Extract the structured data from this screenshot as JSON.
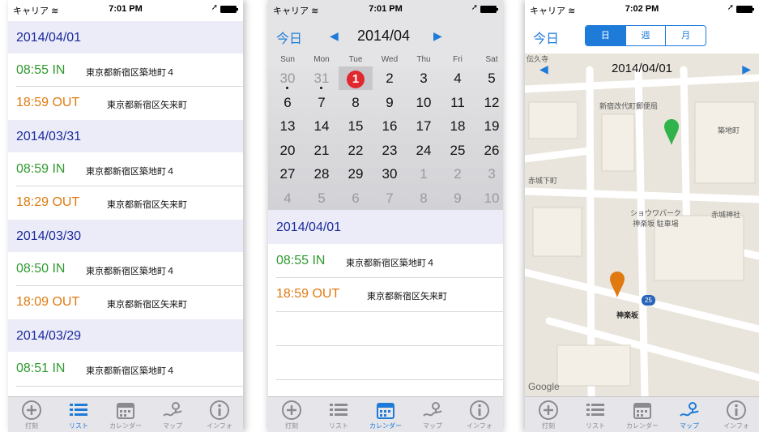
{
  "status": {
    "carrier": "キャリア",
    "time_1": "7:01 PM",
    "time_2": "7:01 PM",
    "time_3": "7:02 PM"
  },
  "list_screen": {
    "groups": [
      {
        "date": "2014/04/01",
        "events": [
          {
            "time": "08:55 IN",
            "addr": "東京都新宿区築地町４"
          },
          {
            "time": "18:59 OUT",
            "addr": "東京都新宿区矢来町"
          }
        ]
      },
      {
        "date": "2014/03/31",
        "events": [
          {
            "time": "08:59 IN",
            "addr": "東京都新宿区築地町４"
          },
          {
            "time": "18:29 OUT",
            "addr": "東京都新宿区矢来町"
          }
        ]
      },
      {
        "date": "2014/03/30",
        "events": [
          {
            "time": "08:50 IN",
            "addr": "東京都新宿区築地町４"
          },
          {
            "time": "18:09 OUT",
            "addr": "東京都新宿区矢来町"
          }
        ]
      },
      {
        "date": "2014/03/29",
        "events": [
          {
            "time": "08:51 IN",
            "addr": "東京都新宿区築地町４"
          }
        ]
      }
    ]
  },
  "calendar_screen": {
    "today_label": "今日",
    "month": "2014/04",
    "weekdays": [
      "Sun",
      "Mon",
      "Tue",
      "Wed",
      "Thu",
      "Fri",
      "Sat"
    ],
    "weeks": [
      [
        "30",
        "31",
        "1",
        "2",
        "3",
        "4",
        "5"
      ],
      [
        "6",
        "7",
        "8",
        "9",
        "10",
        "11",
        "12"
      ],
      [
        "13",
        "14",
        "15",
        "16",
        "17",
        "18",
        "19"
      ],
      [
        "20",
        "21",
        "22",
        "23",
        "24",
        "25",
        "26"
      ],
      [
        "27",
        "28",
        "29",
        "30",
        "1",
        "2",
        "3"
      ],
      [
        "4",
        "5",
        "6",
        "7",
        "8",
        "9",
        "10"
      ]
    ],
    "selected_date": "2014/04/01",
    "events": [
      {
        "time": "08:55 IN",
        "addr": "東京都新宿区築地町４"
      },
      {
        "time": "18:59 OUT",
        "addr": "東京都新宿区矢来町"
      }
    ]
  },
  "map_screen": {
    "today_label": "今日",
    "segments": [
      "日",
      "週",
      "月"
    ],
    "date": "2014/04/01",
    "labels": {
      "post_office": "新宿改代町郵便局",
      "tsukiji": "築地町",
      "akagi_shita": "赤城下町",
      "parking": "ショウワパーク\n神楽坂 駐車場",
      "akagi_shrine": "赤城神社",
      "kagurazaka": "神楽坂",
      "station_num": "25",
      "denzu": "伝久寺",
      "google": "Google"
    }
  },
  "tabs": [
    {
      "label": "打刻",
      "icon": "plus-circle-icon"
    },
    {
      "label": "リスト",
      "icon": "list-icon"
    },
    {
      "label": "カレンダー",
      "icon": "calendar-icon"
    },
    {
      "label": "マップ",
      "icon": "map-icon"
    },
    {
      "label": "インフォ",
      "icon": "info-icon"
    }
  ],
  "colors": {
    "accent": "#1e7bd8",
    "in": "#2f9a2f",
    "out": "#e07a10",
    "header_bg": "#ececf8"
  }
}
